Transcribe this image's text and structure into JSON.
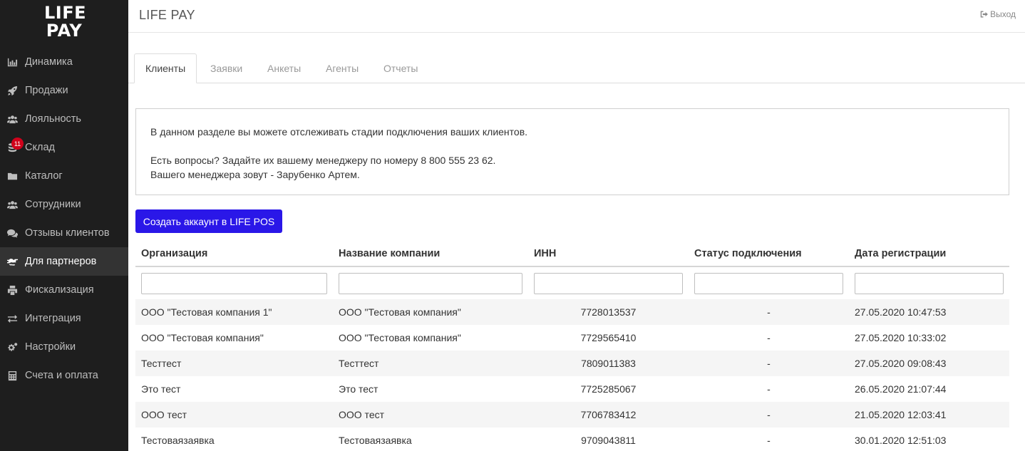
{
  "logo": {
    "line1": "LIFE",
    "line2": "PAY"
  },
  "sidebar": {
    "items": [
      {
        "label": "Динамика",
        "icon": "bar-chart-icon"
      },
      {
        "label": "Продажи",
        "icon": "rocket-icon"
      },
      {
        "label": "Лояльность",
        "icon": "users-icon"
      },
      {
        "label": "Склад",
        "icon": "database-icon",
        "badge": "11"
      },
      {
        "label": "Каталог",
        "icon": "folder-icon"
      },
      {
        "label": "Сотрудники",
        "icon": "users-icon"
      },
      {
        "label": "Отзывы клиентов",
        "icon": "comments-icon"
      },
      {
        "label": "Для партнеров",
        "icon": "handshake-icon",
        "active": true
      },
      {
        "label": "Фискализация",
        "icon": "printer-icon"
      },
      {
        "label": "Интеграция",
        "icon": "exchange-icon"
      },
      {
        "label": "Настройки",
        "icon": "cogs-icon"
      },
      {
        "label": "Счета и оплата",
        "icon": "calculator-icon"
      }
    ]
  },
  "header": {
    "title": "LIFE PAY",
    "logout_label": "Выход"
  },
  "tabs": [
    {
      "label": "Клиенты",
      "active": true
    },
    {
      "label": "Заявки"
    },
    {
      "label": "Анкеты"
    },
    {
      "label": "Агенты"
    },
    {
      "label": "Отчеты"
    }
  ],
  "info": {
    "line1": "В данном разделе вы можете отслеживать стадии подключения ваших клиентов.",
    "line2": "Есть вопросы? Задайте их вашему менеджеру по номеру 8 800 555 23 62.",
    "line3": "Вашего менеджера зовут - Зарубенко Артем."
  },
  "create_button": "Создать аккаунт в LIFE POS",
  "table": {
    "columns": [
      "Организация",
      "Название компании",
      "ИНН",
      "Статус подключения",
      "Дата регистрации"
    ],
    "filters": [
      "",
      "",
      "",
      "",
      ""
    ],
    "rows": [
      [
        "ООО \"Тестовая компания 1\"",
        "ООО \"Тестовая компания\"",
        "7728013537",
        "-",
        "27.05.2020 10:47:53"
      ],
      [
        "ООО \"Тестовая компания\"",
        "ООО \"Тестовая компания\"",
        "7729565410",
        "-",
        "27.05.2020 10:33:02"
      ],
      [
        "Тесттест",
        "Тесттест",
        "7809011383",
        "-",
        "27.05.2020 09:08:43"
      ],
      [
        "Это тест",
        "Это тест",
        "7725285067",
        "-",
        "26.05.2020 21:07:44"
      ],
      [
        "ООО тест",
        "ООО тест",
        "7706783412",
        "-",
        "21.05.2020 12:03:41"
      ],
      [
        "Тестоваязаявка",
        "Тестоваязаявка",
        "9709043811",
        "-",
        "30.01.2020 12:51:03"
      ]
    ]
  },
  "colors": {
    "sidebar_bg": "#1e1e1e",
    "accent_button": "#2a17e8",
    "badge": "#d0021b"
  }
}
